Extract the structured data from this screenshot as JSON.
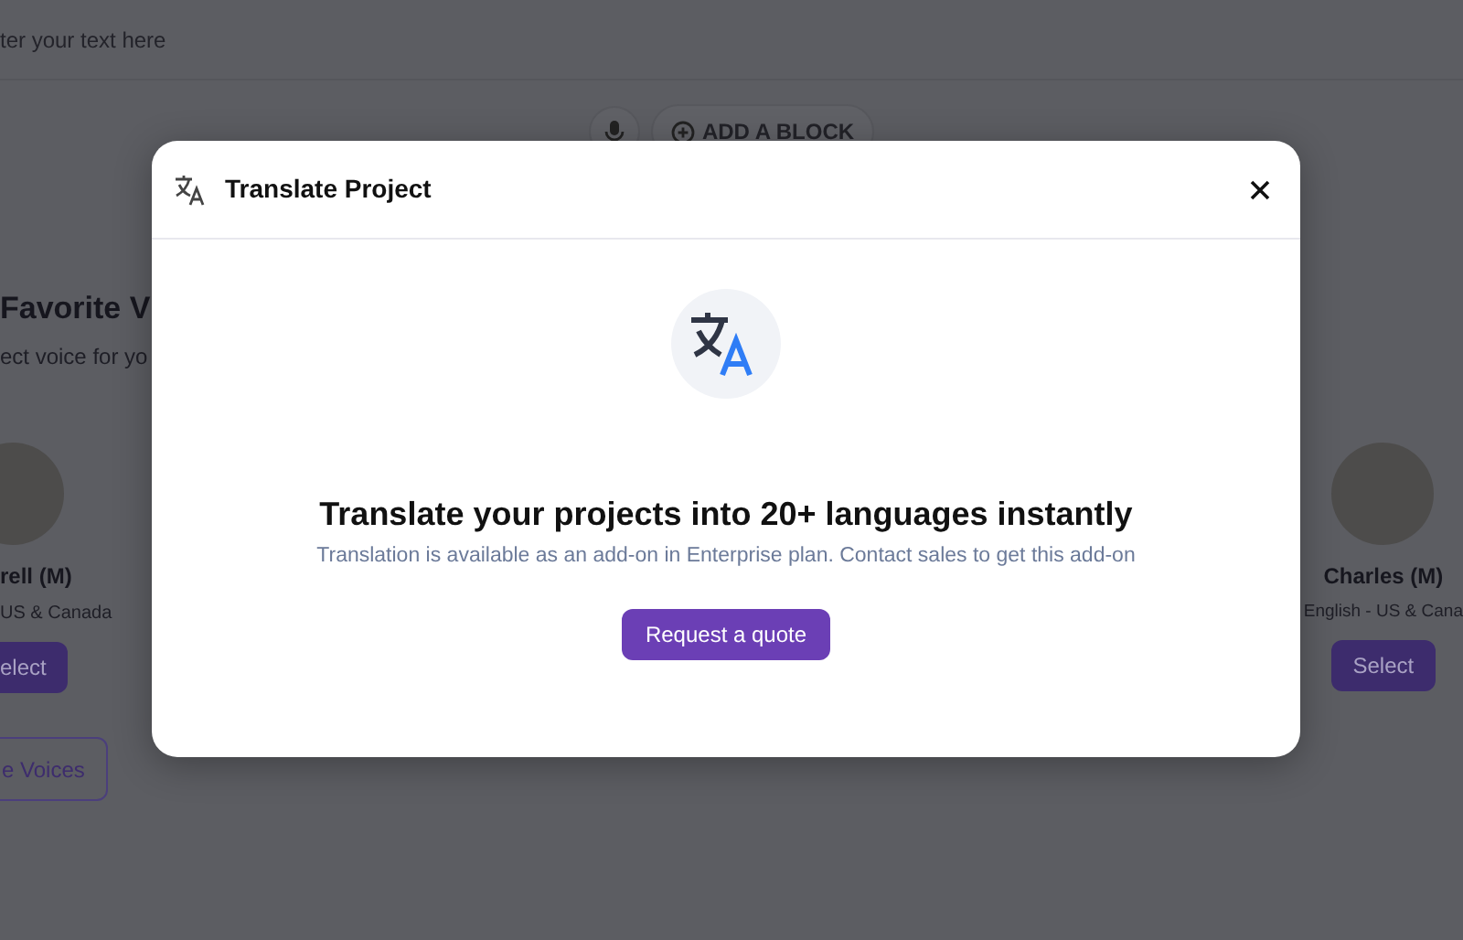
{
  "editor": {
    "placeholder": "ter your text here"
  },
  "add_block": {
    "label": "ADD A BLOCK"
  },
  "voices_section": {
    "title": "Favorite V",
    "subtitle": "ect voice for yo",
    "voices": [
      {
        "name": "rell (M)",
        "accent": "US & Canada",
        "button": "elect"
      },
      {
        "name": "Charles (M)",
        "accent": "English - US & Cana",
        "button": "Select"
      }
    ],
    "more_button": "e Voices"
  },
  "modal": {
    "title": "Translate Project",
    "heading": "Translate your projects into 20+ languages instantly",
    "description": "Translation is available as an add-on in Enterprise plan. Contact sales to get this add-on",
    "button": "Request a quote"
  }
}
